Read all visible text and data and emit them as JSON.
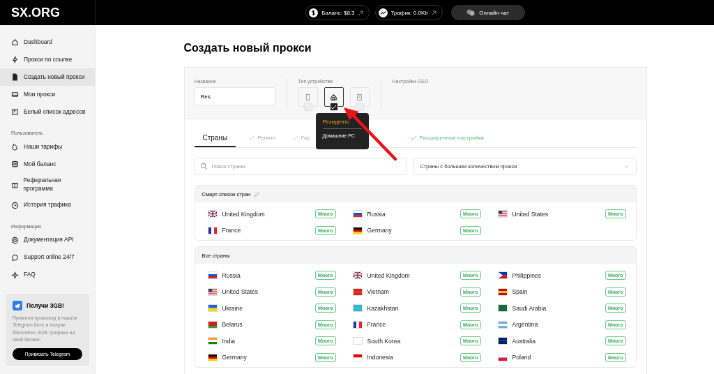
{
  "header": {
    "logo": "SX.ORG",
    "balance": "Баланс: $8.3",
    "traffic": "Трафик: 0.0Kb",
    "chat": "Онлайн чат"
  },
  "sidebar": {
    "sections": [
      {
        "items": [
          {
            "label": "Dashboard",
            "selected": false
          },
          {
            "label": "Прокси по ссылке",
            "selected": false
          },
          {
            "label": "Создать новый прокси",
            "selected": true
          },
          {
            "label": "Мои прокси",
            "selected": false
          },
          {
            "label": "Белый список адресов",
            "selected": false
          }
        ]
      },
      {
        "title": "Пользователь",
        "items": [
          {
            "label": "Наши тарифы",
            "selected": false
          },
          {
            "label": "Мой баланс",
            "selected": false
          },
          {
            "label": "Реферальная программа",
            "selected": false
          },
          {
            "label": "История трафика",
            "selected": false
          }
        ]
      },
      {
        "title": "Информация",
        "items": [
          {
            "label": "Документация API",
            "selected": false
          },
          {
            "label": "Support online 24/7",
            "selected": false
          },
          {
            "label": "FAQ",
            "selected": false
          }
        ]
      }
    ],
    "promo": {
      "title": "Получи 3GB!",
      "text": "Примени промокод в нашем Telegram боте и получи бесплатно 3GB трафика на свой баланс",
      "button": "Привязать Telegram"
    }
  },
  "page": {
    "title": "Создать новый прокси",
    "name_field": {
      "label": "Название",
      "value": "Res"
    },
    "device_type": {
      "label": "Тип устройства",
      "options": [
        {
          "kind": "mobile",
          "selected": false
        },
        {
          "kind": "home",
          "selected": true
        },
        {
          "kind": "office",
          "selected": false
        }
      ]
    },
    "geo_label": "Настройки GEO",
    "tooltip": {
      "title": "Резидентс",
      "text": "Домашние PC"
    },
    "tabs": [
      {
        "label": "Страны",
        "selected": true,
        "done": false
      },
      {
        "label": "Регион",
        "selected": false,
        "done": true
      },
      {
        "label": "Гор",
        "selected": false,
        "done": true
      },
      {
        "label": "Расширенные настройки",
        "selected": false,
        "done": true
      }
    ],
    "search": {
      "placeholder": "Поиск страны"
    },
    "sort_select": {
      "value": "Страны с большим количеством прокси"
    },
    "smart_list": {
      "title": "Смарт-список стран",
      "countries": [
        {
          "name": "United Kingdom",
          "badge": "Много"
        },
        {
          "name": "Russia",
          "badge": "Много"
        },
        {
          "name": "United States",
          "badge": "Много"
        },
        {
          "name": "France",
          "badge": "Много"
        },
        {
          "name": "Germany",
          "badge": "Много"
        }
      ]
    },
    "all_countries": {
      "title": "Все страны",
      "countries": [
        {
          "name": "Russia",
          "badge": "Много"
        },
        {
          "name": "United Kingdom",
          "badge": "Много"
        },
        {
          "name": "Philippines",
          "badge": "Много"
        },
        {
          "name": "United States",
          "badge": "Много"
        },
        {
          "name": "Vietnam",
          "badge": "Много"
        },
        {
          "name": "Spain",
          "badge": "Много"
        },
        {
          "name": "Ukraine",
          "badge": "Много"
        },
        {
          "name": "Kazakhstan",
          "badge": "Много"
        },
        {
          "name": "Saudi Arabia",
          "badge": "Много"
        },
        {
          "name": "Belarus",
          "badge": "Много"
        },
        {
          "name": "France",
          "badge": "Много"
        },
        {
          "name": "Argentina",
          "badge": "Много"
        },
        {
          "name": "India",
          "badge": "Много"
        },
        {
          "name": "South Korea",
          "badge": "Много"
        },
        {
          "name": "Australia",
          "badge": "Много"
        },
        {
          "name": "Germany",
          "badge": "Много"
        },
        {
          "name": "Indonesia",
          "badge": "Много"
        },
        {
          "name": "Poland",
          "badge": "Много"
        }
      ]
    }
  }
}
